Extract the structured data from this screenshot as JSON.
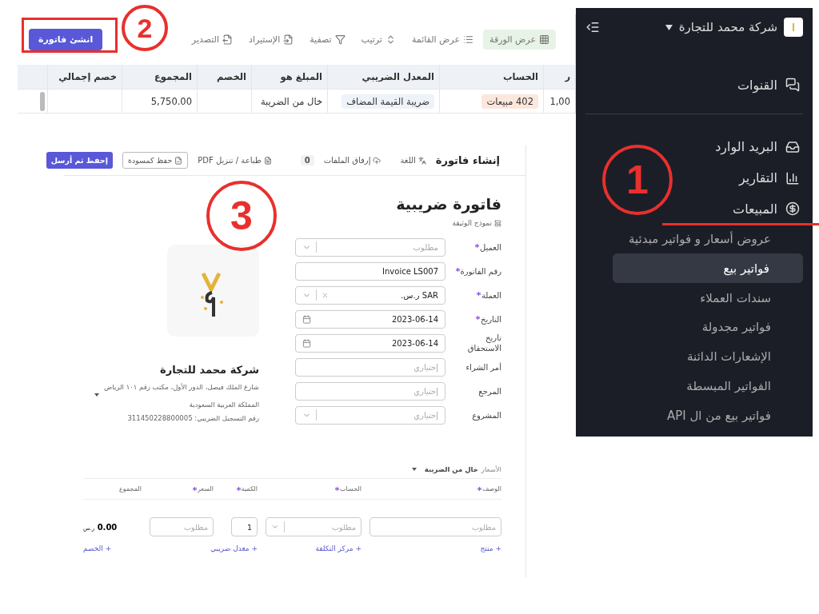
{
  "toolbar": {
    "create_button": "انشئ فاتورة",
    "items": [
      {
        "label": "عرض الورقة",
        "kind": "grid",
        "selected": true
      },
      {
        "label": "عرض القائمة",
        "kind": "list",
        "selected": false
      },
      {
        "label": "ترتيب",
        "kind": "sort",
        "selected": false
      },
      {
        "label": "تصفية",
        "kind": "filter",
        "selected": false
      },
      {
        "label": "الإستيراد",
        "kind": "import",
        "selected": false
      },
      {
        "label": "التصدير",
        "kind": "export",
        "selected": false
      }
    ]
  },
  "table": {
    "columns": [
      "ر",
      "الحساب",
      "المعدل الضريبي",
      "المبلغ هو",
      "الخصم",
      "المجموع",
      "خصم إجمالي"
    ],
    "rows": [
      {
        "cells": [
          {
            "text": "1,00",
            "kind": "text"
          },
          {
            "text": "402 مبيعات",
            "kind": "tag"
          },
          {
            "text": "ضريبة القيمة المضاف",
            "kind": "pill"
          },
          {
            "text": "خال من الضريبة",
            "kind": "text"
          },
          {},
          {
            "text": "5,750.00",
            "kind": "text"
          },
          {}
        ]
      }
    ]
  },
  "invoice_form": {
    "title": "إنشاء فاتورة",
    "language": "اللغة",
    "attach": "إرفاق الملفات",
    "attach_count": "0",
    "print": "طباعة / تنزيل PDF",
    "save_draft": "حفظ كمسودة",
    "save_send": "إحفظ ثم أرسل",
    "doc_title": "فاتورة ضريبية",
    "template": "نموذج الوثيقة",
    "fields": [
      {
        "label": "العميل",
        "required": true,
        "kind": "select",
        "placeholder": "مطلوب"
      },
      {
        "label": "رقم الفاتورة",
        "required": true,
        "kind": "text",
        "value": "Invoice LS007"
      },
      {
        "label": "العملة",
        "required": true,
        "kind": "select",
        "value": "SAR ر.س.",
        "clearable": true
      },
      {
        "label": "التاريخ",
        "required": true,
        "kind": "date",
        "value": "2023-06-14"
      },
      {
        "label": "تاريخ الاستحقاق",
        "required": false,
        "kind": "date",
        "value": "2023-06-14"
      },
      {
        "label": "أمر الشراء",
        "required": false,
        "kind": "text",
        "placeholder": "إختياري"
      },
      {
        "label": "المرجع",
        "required": false,
        "kind": "text",
        "placeholder": "إختياري"
      },
      {
        "label": "المشروع",
        "required": false,
        "kind": "select",
        "placeholder": "إختياري"
      }
    ],
    "company": {
      "name": "شركة محمد للتجارة",
      "address": "شارع الملك فيصل، الدور الأول، مكتب رقم ١٠١ الرياض",
      "country": "المملكة العربية السعودية",
      "tax_number": "رقم التسجيل الضريبي: 311450228800005"
    },
    "prices_label": "الأسعار",
    "prices_mode": "خال من الضريبة",
    "line_columns": [
      {
        "label": "الوصف",
        "required": true
      },
      {
        "label": "الحساب",
        "required": true
      },
      {
        "label": "الكمية",
        "required": true
      },
      {
        "label": "السعر",
        "required": true
      },
      {
        "label": "المجموع",
        "required": false
      }
    ],
    "line": {
      "description": "مطلوب",
      "account": "مطلوب",
      "quantity": "1",
      "price": "مطلوب",
      "total": "0.00",
      "currency": "ر.س"
    },
    "links": [
      "+ منتج",
      "+ مركز التكلفة",
      "+ معدل ضريبي",
      "+ الخصم"
    ]
  },
  "sidebar": {
    "company": "شركة محمد للتجارة",
    "items": [
      {
        "label": "القنوات",
        "kind": "channels",
        "expanded": false
      },
      {
        "label": "البريد الوارد",
        "kind": "inbox",
        "expanded": false
      },
      {
        "label": "التقارير",
        "kind": "reports",
        "expanded": false
      },
      {
        "label": "المبيعات",
        "kind": "sales",
        "expanded": true,
        "children": [
          {
            "label": "عروض أسعار و فواتير مبدئية",
            "selected": false
          },
          {
            "label": "فواتير بيع",
            "selected": true
          },
          {
            "label": "سندات العملاء",
            "selected": false
          },
          {
            "label": "فواتير مجدولة",
            "selected": false
          },
          {
            "label": "الإشعارات الدائنة",
            "selected": false
          },
          {
            "label": "الفواتير المبسطة",
            "selected": false
          },
          {
            "label": "فواتير بيع من ال API",
            "selected": false
          }
        ]
      }
    ]
  },
  "annotations": [
    "1",
    "2",
    "3"
  ]
}
